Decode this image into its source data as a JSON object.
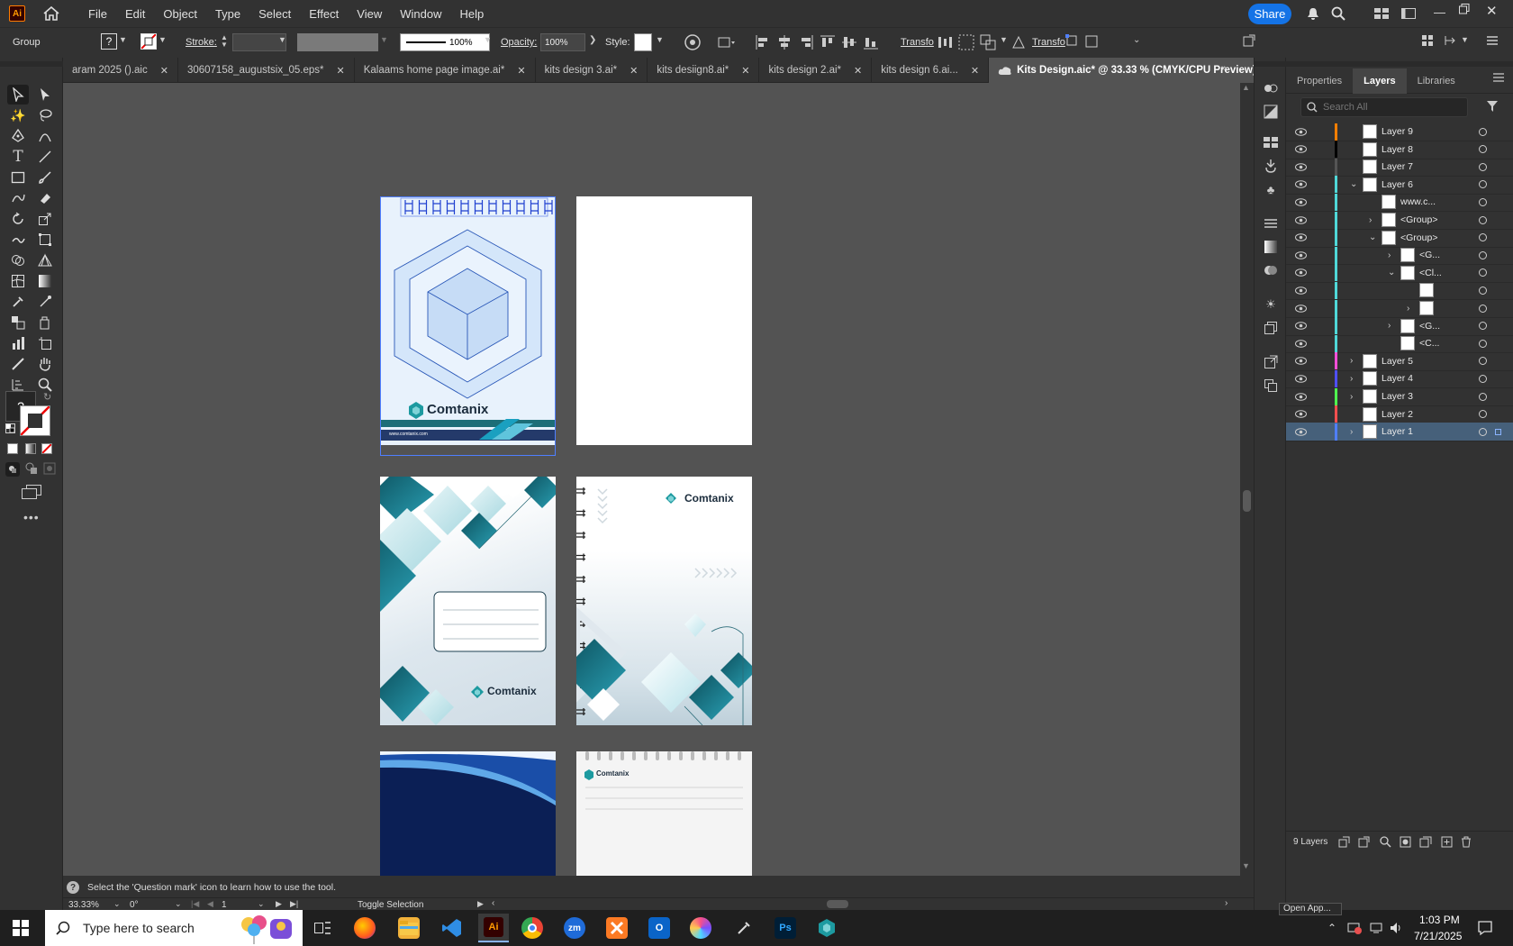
{
  "app": {
    "logo": "Ai"
  },
  "menu": [
    "File",
    "Edit",
    "Object",
    "Type",
    "Select",
    "Effect",
    "View",
    "Window",
    "Help"
  ],
  "share_label": "Share",
  "control": {
    "selection_type": "Group",
    "stroke_label": "Stroke:",
    "stroke_profile": "100%",
    "opacity_label": "Opacity:",
    "opacity_value": "100%",
    "style_label": "Style:",
    "transform_label_1": "Transfo",
    "transform_label_2": "Transfo"
  },
  "tabs": [
    {
      "label": "aram 2025 ().aic"
    },
    {
      "label": "30607158_augustsix_05.eps*"
    },
    {
      "label": "Kalaams home page image.ai*"
    },
    {
      "label": "kits design 3.ai*"
    },
    {
      "label": "kits desiign8.ai*"
    },
    {
      "label": "kits design 2.ai*"
    },
    {
      "label": "kits design 6.ai..."
    },
    {
      "label": "Kits Design.aic* @ 33.33 % (CMYK/CPU Preview)"
    }
  ],
  "artwork": {
    "brand": "Comtanix",
    "website": "www.comtanix.com"
  },
  "panel": {
    "tabs": [
      "Properties",
      "Layers",
      "Libraries"
    ],
    "search_placeholder": "Search All",
    "layers": [
      {
        "name": "Layer 9",
        "color": "#ff7f00",
        "indent": 0,
        "chev": ""
      },
      {
        "name": "Layer 8",
        "color": "#000000",
        "indent": 0,
        "chev": ""
      },
      {
        "name": "Layer 7",
        "color": "#555555",
        "indent": 0,
        "chev": ""
      },
      {
        "name": "Layer 6",
        "color": "#4fd8d8",
        "indent": 0,
        "chev": "down"
      },
      {
        "name": "www.c...",
        "color": "#4fd8d8",
        "indent": 1,
        "chev": ""
      },
      {
        "name": "<Group>",
        "color": "#4fd8d8",
        "indent": 1,
        "chev": "right"
      },
      {
        "name": "<Group>",
        "color": "#4fd8d8",
        "indent": 1,
        "chev": "down"
      },
      {
        "name": "<G...",
        "color": "#4fd8d8",
        "indent": 2,
        "chev": "right"
      },
      {
        "name": "<Cl...",
        "color": "#4fd8d8",
        "indent": 2,
        "chev": "down"
      },
      {
        "name": "",
        "color": "#4fd8d8",
        "indent": 3,
        "chev": ""
      },
      {
        "name": "",
        "color": "#4fd8d8",
        "indent": 3,
        "chev": "right"
      },
      {
        "name": "<G...",
        "color": "#4fd8d8",
        "indent": 2,
        "chev": "right"
      },
      {
        "name": "<C...",
        "color": "#4fd8d8",
        "indent": 2,
        "chev": ""
      },
      {
        "name": "Layer 5",
        "color": "#ff4fd8",
        "indent": 0,
        "chev": "right"
      },
      {
        "name": "Layer 4",
        "color": "#4f4fff",
        "indent": 0,
        "chev": "right"
      },
      {
        "name": "Layer 3",
        "color": "#4fff4f",
        "indent": 0,
        "chev": "right"
      },
      {
        "name": "Layer 2",
        "color": "#ff4f4f",
        "indent": 0,
        "chev": ""
      },
      {
        "name": "Layer 1",
        "color": "#4f7fff",
        "indent": 0,
        "chev": "right",
        "selected": true
      }
    ],
    "footer_count": "9 Layers"
  },
  "status": {
    "hint": "Select the 'Question mark' icon to learn how to use the tool.",
    "zoom": "33.33%",
    "rotation": "0°",
    "artboard_num": "1",
    "mode": "Toggle Selection"
  },
  "taskbar": {
    "search_placeholder": "Type here to search",
    "time": "1:03 PM",
    "date": "7/21/2025",
    "tooltip": "Open App..."
  }
}
